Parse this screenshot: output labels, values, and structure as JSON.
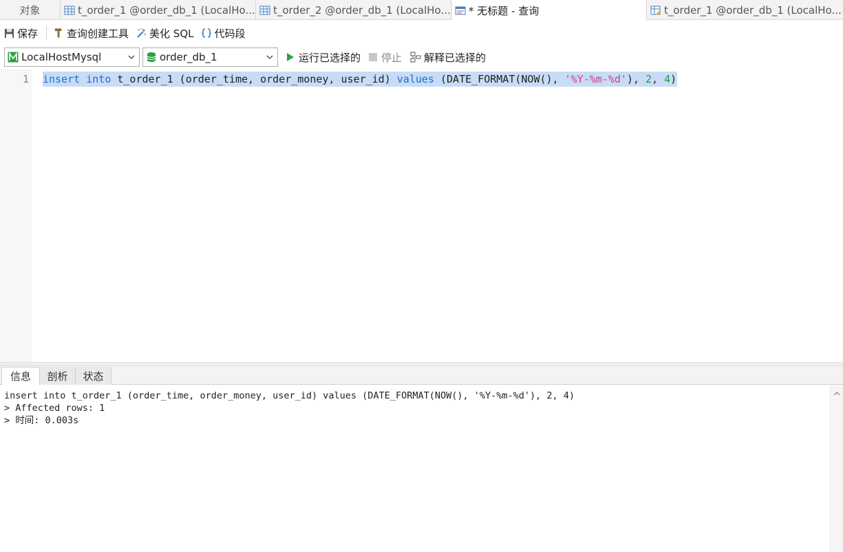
{
  "tabs": {
    "objects": "对象",
    "items": [
      {
        "label": "t_order_1 @order_db_1 (LocalHo..."
      },
      {
        "label": "t_order_2 @order_db_1 (LocalHo..."
      },
      {
        "label": "* 无标题 - 查询"
      },
      {
        "label": "t_order_1 @order_db_1 (LocalHo..."
      }
    ]
  },
  "toolbar": {
    "save": "保存",
    "query_builder": "查询创建工具",
    "beautify": "美化 SQL",
    "snippet": "代码段"
  },
  "connection": {
    "server": "LocalHostMysql",
    "database": "order_db_1",
    "run": "运行已选择的",
    "stop": "停止",
    "explain": "解释已选择的"
  },
  "editor": {
    "line_number": "1",
    "tokens": {
      "t1": "insert",
      "t2": " ",
      "t3": "into",
      "t4": " t_order_1 (order_time, order_money, user_id) ",
      "t5": "values",
      "t6": " (DATE_FORMAT(NOW(), ",
      "t7": "'%Y-%m-%d'",
      "t8": "), ",
      "t9": "2",
      "t10": ", ",
      "t11": "4",
      "t12": ")"
    }
  },
  "result_tabs": [
    "信息",
    "剖析",
    "状态"
  ],
  "output": {
    "lines": [
      "insert into t_order_1 (order_time, order_money, user_id) values (DATE_FORMAT(NOW(), '%Y-%m-%d'), 2, 4)",
      "> Affected rows: 1",
      "> 时间: 0.003s"
    ]
  }
}
